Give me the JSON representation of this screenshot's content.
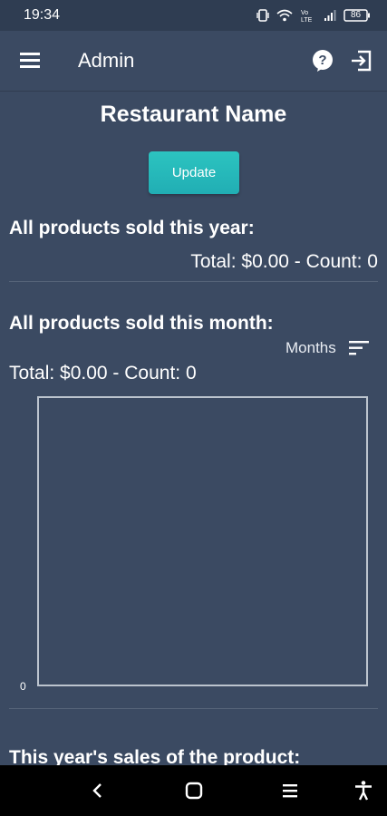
{
  "status_bar": {
    "time": "19:34",
    "battery": "86",
    "icons": [
      "vibrate-icon",
      "wifi-icon",
      "volte-icon",
      "signal-icon",
      "battery-icon"
    ]
  },
  "app_bar": {
    "title": "Admin",
    "icons": [
      "menu-icon",
      "help-icon",
      "logout-icon"
    ]
  },
  "restaurant": {
    "name": "Restaurant Name"
  },
  "update_button": {
    "label": "Update"
  },
  "year_section": {
    "title": "All products sold this year:",
    "total": "Total: $0.00 - Count: 0"
  },
  "month_section": {
    "title": "All products sold this month:",
    "sort_label": "Months",
    "total": "Total: $0.00 - Count: 0"
  },
  "chart_data": {
    "type": "bar",
    "categories": [],
    "values": [],
    "title": "",
    "xlabel": "",
    "ylabel": "",
    "y_ticks": [
      "0"
    ]
  },
  "product_section": {
    "title": "This year's sales of the product:"
  },
  "colors": {
    "background": "#3b4a62",
    "status_bar": "#2f3d52",
    "accent": "#2cc4c0",
    "nav_bar": "#000000"
  },
  "nav_bar": {
    "icons": [
      "back-icon",
      "home-icon",
      "recents-icon",
      "accessibility-icon"
    ]
  }
}
